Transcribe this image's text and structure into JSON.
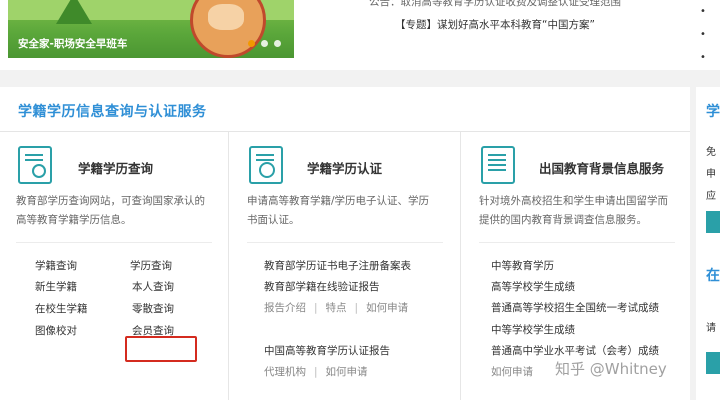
{
  "banner": {
    "caption": "安全家-职场安全早班车"
  },
  "news": {
    "line1": "公告：取消高等教育学历认证收费及调整认证受理范围",
    "line2": "【专题】谋划好高水平本科教育“中国方案”"
  },
  "right_bullets": [
    "•",
    "•",
    "•"
  ],
  "section": {
    "title": "学籍学历信息查询与认证服务"
  },
  "col1": {
    "title": "学籍学历查询",
    "desc_line1": "教育部学历查询网站，可查询国家承认的",
    "desc_line2": "高等教育学籍学历信息。",
    "head_left": "学籍查询",
    "head_right": "学历查询",
    "left_items": [
      "新生学籍",
      "在校生学籍",
      "图像校对"
    ],
    "right_items": [
      "本人查询",
      "零散查询",
      "会员查询"
    ]
  },
  "col2": {
    "title": "学籍学历认证",
    "desc_line1": "申请高等教育学籍/学历电子认证、学历",
    "desc_line2": "书面认证。",
    "item1": "教育部学历证书电子注册备案表",
    "item2": "教育部学籍在线验证报告",
    "links_a": [
      "报告介绍",
      "特点",
      "如何申请"
    ],
    "item3": "中国高等教育学历认证报告",
    "links_b": [
      "代理机构",
      "如何申请"
    ],
    "pipe": "|"
  },
  "col3": {
    "title": "出国教育背景信息服务",
    "desc_line1": "针对境外高校招生和学生申请出国留学而",
    "desc_line2": "提供的国内教育背景调查信息服务。",
    "items": [
      "中等教育学历",
      "高等学校学生成绩",
      "普通高等学校招生全国统一考试成绩",
      "中等学校学生成绩",
      "普通高中学业水平考试（会考）成绩"
    ],
    "last_link": "如何申请"
  },
  "side": {
    "title": "学",
    "t1": "免",
    "t2": "申",
    "t3": "应",
    "t4": "在",
    "t5": "请"
  },
  "watermark": "知乎 @Whitney"
}
